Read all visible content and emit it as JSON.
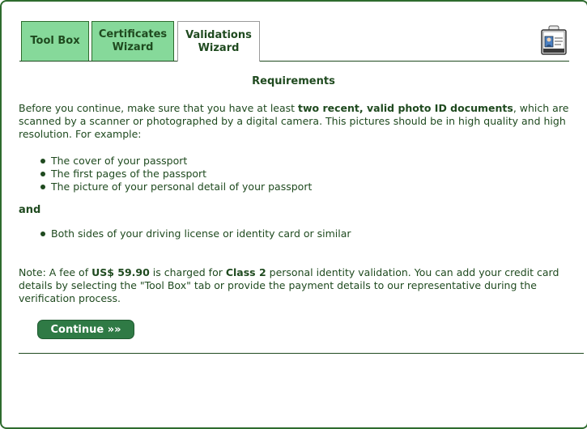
{
  "tabs": [
    {
      "label_line1": "Tool Box",
      "label_line2": ""
    },
    {
      "label_line1": "Certificates",
      "label_line2": "Wizard"
    },
    {
      "label_line1": "Validations",
      "label_line2": "Wizard"
    }
  ],
  "header_icon": "id-badge-icon",
  "main": {
    "title": "Requirements",
    "intro": {
      "part1": "Before you continue, make sure that you have at least ",
      "bold": "two recent, valid photo ID documents",
      "part2": ", which are scanned by a scanner or photographed by a digital camera. This pictures should be in high quality and high resolution. For example:"
    },
    "passport_items": [
      "The cover of your passport",
      "The first pages of the passport",
      "The picture of your personal detail of your passport"
    ],
    "and_label": "and",
    "license_items": [
      "Both sides of your driving license or identity card or similar"
    ],
    "note": {
      "part1": "Note: A fee of ",
      "fee": "US$ 59.90",
      "part2": " is charged for ",
      "class": "Class 2",
      "part3": " personal identity validation. You can add your credit card details by selecting the \"Tool Box\" tab or provide the payment details to our representative during the verification process."
    },
    "continue_label": "Continue »»"
  },
  "colors": {
    "accent": "#2f7a45",
    "tab_inactive": "#86d99a",
    "text": "#1f4a1f"
  }
}
